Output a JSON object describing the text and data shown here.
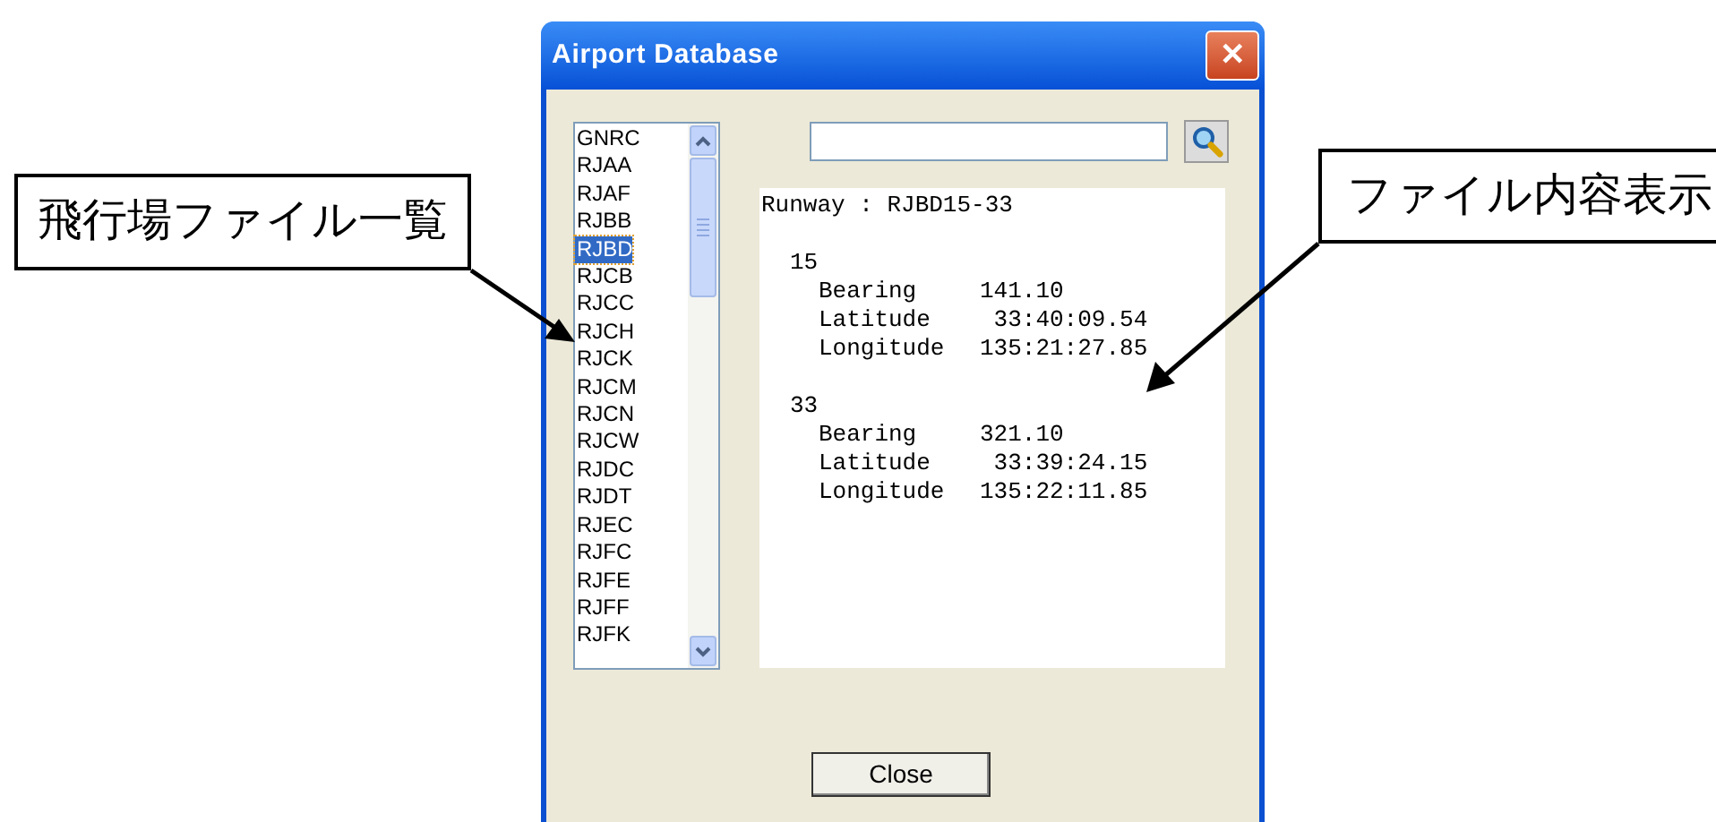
{
  "window": {
    "title": "Airport Database",
    "close_glyph": "✕"
  },
  "airport_list": {
    "items": [
      {
        "label": "GNRC",
        "selected": false
      },
      {
        "label": "RJAA",
        "selected": false
      },
      {
        "label": "RJAF",
        "selected": false
      },
      {
        "label": "RJBB",
        "selected": false
      },
      {
        "label": "RJBD",
        "selected": true
      },
      {
        "label": "RJCB",
        "selected": false
      },
      {
        "label": "RJCC",
        "selected": false
      },
      {
        "label": "RJCH",
        "selected": false
      },
      {
        "label": "RJCK",
        "selected": false
      },
      {
        "label": "RJCM",
        "selected": false
      },
      {
        "label": "RJCN",
        "selected": false
      },
      {
        "label": "RJCW",
        "selected": false
      },
      {
        "label": "RJDC",
        "selected": false
      },
      {
        "label": "RJDT",
        "selected": false
      },
      {
        "label": "RJEC",
        "selected": false
      },
      {
        "label": "RJFC",
        "selected": false
      },
      {
        "label": "RJFE",
        "selected": false
      },
      {
        "label": "RJFF",
        "selected": false
      },
      {
        "label": "RJFK",
        "selected": false
      }
    ]
  },
  "file_view": {
    "header": "Runway : RJBD15-33",
    "runways": [
      {
        "id": "15",
        "fields": [
          {
            "label": "Bearing",
            "value": "141.10"
          },
          {
            "label": "Latitude",
            "value": " 33:40:09.54"
          },
          {
            "label": "Longitude",
            "value": "135:21:27.85"
          }
        ]
      },
      {
        "id": "33",
        "fields": [
          {
            "label": "Bearing",
            "value": "321.10"
          },
          {
            "label": "Latitude",
            "value": " 33:39:24.15"
          },
          {
            "label": "Longitude",
            "value": "135:22:11.85"
          }
        ]
      }
    ]
  },
  "buttons": [
    {
      "label": "Close"
    }
  ],
  "callouts": [
    {
      "text": "飛行場ファイル一覧"
    },
    {
      "text": "ファイル内容表示"
    }
  ]
}
